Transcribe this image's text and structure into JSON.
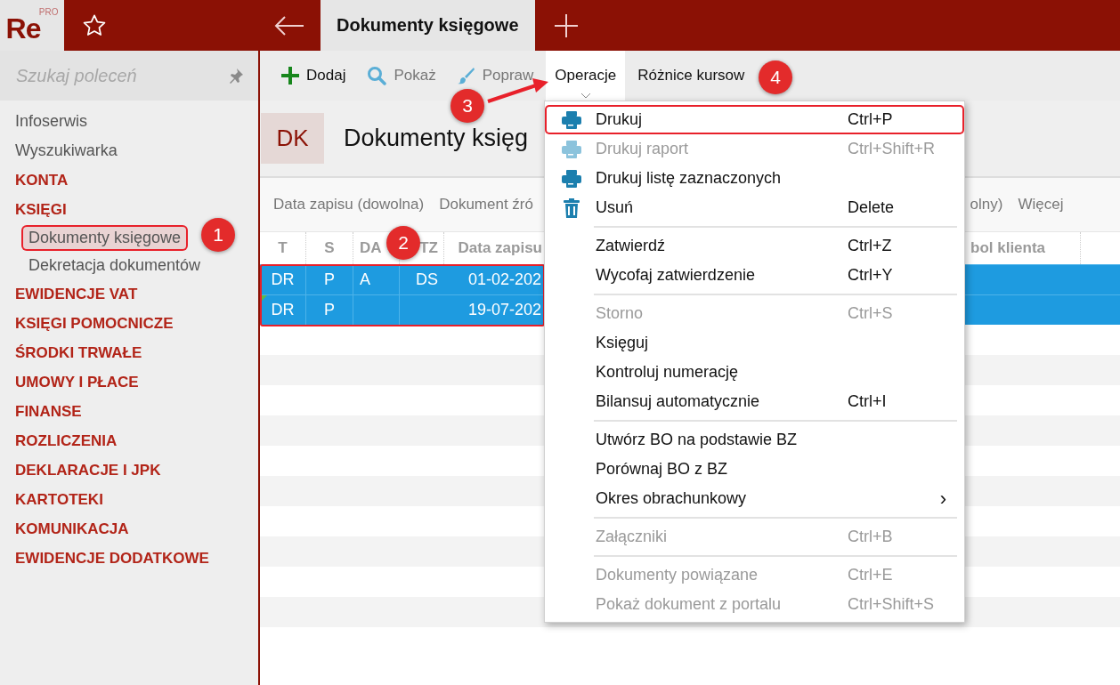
{
  "app": {
    "logo": "Re",
    "logo_sup": "PRO"
  },
  "tabs": [
    {
      "label": "Dokumenty księgowe",
      "selected": true
    }
  ],
  "sidebar": {
    "search": {
      "placeholder": "Szukaj poleceń"
    },
    "items": [
      {
        "label": "Infoserwis",
        "kind": "link"
      },
      {
        "label": "Wyszukiwarka",
        "kind": "link"
      },
      {
        "label": "KONTA",
        "kind": "section"
      },
      {
        "label": "KSIĘGI",
        "kind": "section",
        "children": [
          {
            "label": "Dokumenty księgowe",
            "selected": true,
            "annotated": true
          },
          {
            "label": "Dekretacja dokumentów",
            "selected": false,
            "annotated": false
          }
        ]
      },
      {
        "label": "EWIDENCJE VAT",
        "kind": "section"
      },
      {
        "label": "KSIĘGI POMOCNICZE",
        "kind": "section"
      },
      {
        "label": "ŚRODKI TRWAŁE",
        "kind": "section"
      },
      {
        "label": "UMOWY I PŁACE",
        "kind": "section"
      },
      {
        "label": "FINANSE",
        "kind": "section"
      },
      {
        "label": "ROZLICZENIA",
        "kind": "section"
      },
      {
        "label": "DEKLARACJE I JPK",
        "kind": "section"
      },
      {
        "label": "KARTOTEKI",
        "kind": "section"
      },
      {
        "label": "KOMUNIKACJA",
        "kind": "section"
      },
      {
        "label": "EWIDENCJE DODATKOWE",
        "kind": "section"
      }
    ]
  },
  "toolbar": [
    {
      "label": "Dodaj",
      "kind": "add",
      "disabled": false,
      "selected": false
    },
    {
      "label": "Pokaż",
      "kind": "view",
      "disabled": true,
      "selected": false
    },
    {
      "label": "Popraw",
      "kind": "edit",
      "disabled": true,
      "selected": false
    },
    {
      "label": "Operacje",
      "kind": "dropdown",
      "disabled": false,
      "selected": true
    },
    {
      "label": "Różnice kursow",
      "kind": "plain",
      "disabled": false,
      "selected": false
    }
  ],
  "header": {
    "badge": "DK",
    "title": "Dokumenty księg"
  },
  "filters_left": [
    "Data zapisu (dowolna)",
    "Dokument źró"
  ],
  "filters_right": [
    "olny)",
    "Więcej"
  ],
  "table": {
    "annotated": true,
    "columns": [
      "T",
      "S",
      "DA",
      "TZ",
      "Data zapisu",
      "bol klienta"
    ],
    "rows": [
      {
        "cells": [
          "DR",
          "P",
          "A",
          "DS",
          "01-02-202"
        ],
        "selected": true,
        "flagged": false
      },
      {
        "cells": [
          "DR",
          "P",
          "",
          "",
          "19-07-202"
        ],
        "selected": true,
        "flagged": true
      }
    ]
  },
  "menu": [
    {
      "kind": "print",
      "label": "Drukuj",
      "shortcut": "Ctrl+P",
      "disabled": false,
      "annotated": true
    },
    {
      "kind": "print",
      "label": "Drukuj raport",
      "shortcut": "Ctrl+Shift+R",
      "disabled": true,
      "annotated": false
    },
    {
      "kind": "print",
      "label": "Drukuj listę zaznaczonych",
      "disabled": false,
      "annotated": false
    },
    {
      "kind": "delete",
      "label": "Usuń",
      "shortcut": "Delete",
      "disabled": false,
      "annotated": false
    },
    {
      "kind": "separator"
    },
    {
      "kind": "item",
      "label": "Zatwierdź",
      "shortcut": "Ctrl+Z",
      "disabled": false,
      "annotated": false
    },
    {
      "kind": "item",
      "label": "Wycofaj zatwierdzenie",
      "shortcut": "Ctrl+Y",
      "disabled": false,
      "annotated": false
    },
    {
      "kind": "separator"
    },
    {
      "kind": "item",
      "label": "Storno",
      "shortcut": "Ctrl+S",
      "disabled": true,
      "annotated": false
    },
    {
      "kind": "item",
      "label": "Księguj",
      "disabled": false,
      "annotated": false
    },
    {
      "kind": "item",
      "label": "Kontroluj numerację",
      "disabled": false,
      "annotated": false
    },
    {
      "kind": "item",
      "label": "Bilansuj automatycznie",
      "shortcut": "Ctrl+I",
      "disabled": false,
      "annotated": false
    },
    {
      "kind": "separator"
    },
    {
      "kind": "item",
      "label": "Utwórz BO na podstawie BZ",
      "disabled": false,
      "annotated": false
    },
    {
      "kind": "item",
      "label": "Porównaj BO z BZ",
      "disabled": false,
      "annotated": false
    },
    {
      "kind": "submenu",
      "label": "Okres obrachunkowy",
      "arrow": "›",
      "disabled": false,
      "annotated": false
    },
    {
      "kind": "separator"
    },
    {
      "kind": "item",
      "label": "Załączniki",
      "shortcut": "Ctrl+B",
      "disabled": true,
      "annotated": false
    },
    {
      "kind": "separator"
    },
    {
      "kind": "item",
      "label": "Dokumenty powiązane",
      "shortcut": "Ctrl+E",
      "disabled": true,
      "annotated": false
    },
    {
      "kind": "item",
      "label": "Pokaż dokument z portalu",
      "shortcut": "Ctrl+Shift+S",
      "disabled": true,
      "annotated": false
    }
  ],
  "annotations": {
    "badges": [
      "1",
      "2",
      "3",
      "4"
    ],
    "arrow": true
  }
}
